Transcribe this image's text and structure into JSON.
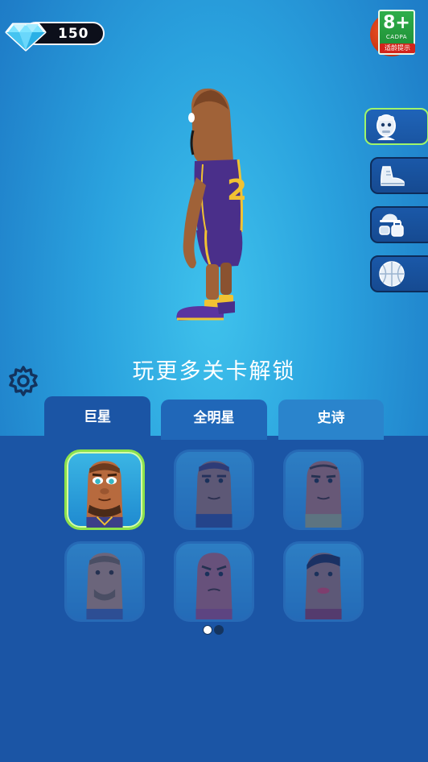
{
  "currency": {
    "gems": "150",
    "icon": "diamond-icon"
  },
  "age_rating": {
    "label": "8+",
    "brand": "CADPA",
    "note": "适龄提示"
  },
  "category_tabs": [
    {
      "name": "head",
      "icon": "head-icon",
      "active": true
    },
    {
      "name": "shoes",
      "icon": "shoe-icon",
      "active": false
    },
    {
      "name": "accessories",
      "icon": "accessories-icon",
      "active": false
    },
    {
      "name": "ball",
      "icon": "basketball-icon",
      "active": false
    }
  ],
  "player": {
    "jersey_number": "2",
    "jersey_color": "#4a2f8a",
    "trim_color": "#f1c232"
  },
  "unlock_text": "玩更多关卡解锁",
  "rarity_tabs": [
    {
      "label": "巨星",
      "active": true
    },
    {
      "label": "全明星",
      "active": false
    },
    {
      "label": "史诗",
      "active": false
    }
  ],
  "characters": [
    {
      "id": "c1",
      "selected": true,
      "locked": false
    },
    {
      "id": "c2",
      "selected": false,
      "locked": true
    },
    {
      "id": "c3",
      "selected": false,
      "locked": true
    },
    {
      "id": "c4",
      "selected": false,
      "locked": true
    },
    {
      "id": "c5",
      "selected": false,
      "locked": true
    },
    {
      "id": "c6",
      "selected": false,
      "locked": true
    }
  ],
  "pagination": {
    "current": 1,
    "total": 2
  },
  "colors": {
    "panel": "#1b55a5",
    "selected_border": "#8de24b",
    "background_top": "#3fc2ec"
  }
}
